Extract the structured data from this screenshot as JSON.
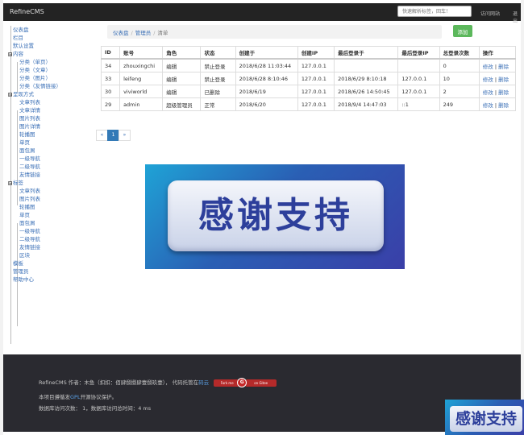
{
  "navbar": {
    "brand": "RefineCMS",
    "search_placeholder": "快速解析标签，回车！",
    "link_visit": "访问网站",
    "link_logout": "退出"
  },
  "sidebar": {
    "items": [
      {
        "label": "仪表盘",
        "level": 1
      },
      {
        "label": "栏目",
        "level": 1
      },
      {
        "label": "默认设置",
        "level": 1
      },
      {
        "label": "内容",
        "level": 0,
        "toggle": "⊟"
      },
      {
        "label": "分类（单页）",
        "level": 2
      },
      {
        "label": "分类（文章）",
        "level": 2
      },
      {
        "label": "分类（图片）",
        "level": 2
      },
      {
        "label": "分类（友情链接）",
        "level": 2
      },
      {
        "label": "呈现方式",
        "level": 0,
        "toggle": "⊟"
      },
      {
        "label": "文章列表",
        "level": 2
      },
      {
        "label": "文章详情",
        "level": 2
      },
      {
        "label": "图片列表",
        "level": 2
      },
      {
        "label": "图片详情",
        "level": 2
      },
      {
        "label": "轮播图",
        "level": 2
      },
      {
        "label": "单页",
        "level": 2
      },
      {
        "label": "面包屑",
        "level": 2
      },
      {
        "label": "一级导航",
        "level": 2
      },
      {
        "label": "二级导航",
        "level": 2
      },
      {
        "label": "友情链接",
        "level": 2
      },
      {
        "label": "标签",
        "level": 0,
        "toggle": "⊟"
      },
      {
        "label": "文章列表",
        "level": 2
      },
      {
        "label": "图片列表",
        "level": 2
      },
      {
        "label": "轮播图",
        "level": 2
      },
      {
        "label": "单页",
        "level": 2
      },
      {
        "label": "面包屑",
        "level": 2
      },
      {
        "label": "一级导航",
        "level": 2
      },
      {
        "label": "二级导航",
        "level": 2
      },
      {
        "label": "友情链接",
        "level": 2
      },
      {
        "label": "区块",
        "level": 2
      },
      {
        "label": "模板",
        "level": 1
      },
      {
        "label": "管理员",
        "level": 1
      },
      {
        "label": "帮助中心",
        "level": 1
      }
    ]
  },
  "breadcrumb": {
    "items": [
      "仪表盘",
      "管理员",
      "清单"
    ]
  },
  "add_button": "添加",
  "table": {
    "headers": [
      "ID",
      "账号",
      "角色",
      "状态",
      "创建于",
      "创建IP",
      "最后登录于",
      "最后登录IP",
      "总登录次数",
      "操作"
    ],
    "rows": [
      {
        "id": "34",
        "account": "zhouxingchi",
        "role": "编辑",
        "status": "禁止登录",
        "created": "2018/6/28 11:03:44",
        "created_ip": "127.0.0.1",
        "last_login": "",
        "last_ip": "",
        "count": "0"
      },
      {
        "id": "33",
        "account": "leifeng",
        "role": "编辑",
        "status": "禁止登录",
        "created": "2018/6/28 8:10:46",
        "created_ip": "127.0.0.1",
        "last_login": "2018/6/29 8:10:18",
        "last_ip": "127.0.0.1",
        "count": "10"
      },
      {
        "id": "30",
        "account": "viviworld",
        "role": "编辑",
        "status": "已删除",
        "created": "2018/6/19",
        "created_ip": "127.0.0.1",
        "last_login": "2018/6/26 14:50:45",
        "last_ip": "127.0.0.1",
        "count": "2"
      },
      {
        "id": "29",
        "account": "admin",
        "role": "超级管理员",
        "status": "正常",
        "created": "2018/6/20",
        "created_ip": "127.0.0.1",
        "last_login": "2018/9/4 14:47:03",
        "last_ip": "::1",
        "count": "249"
      }
    ],
    "action_edit": "修改",
    "action_sep": " | ",
    "action_delete": "删除"
  },
  "pagination": {
    "prev": "«",
    "current": "1",
    "next": "»"
  },
  "banner": {
    "text": "感谢支持"
  },
  "footer": {
    "line1_prefix": "RefineCMS 作者：木鱼（扣扣：佰肆捌捌肆壹捌玖壹）， 代码托管在",
    "line1_link": "码云",
    "badge_left": "Fork me",
    "badge_mid": "G",
    "badge_right": "on Gitee",
    "line2_prefix": "本项目遵循发",
    "line2_link": "GPL",
    "line2_suffix": "开源协议保护。",
    "line3": "数据库访问次数： 1，数据库访问总时间：4 ms"
  },
  "corner_thumb": {
    "text": "感谢支持"
  }
}
